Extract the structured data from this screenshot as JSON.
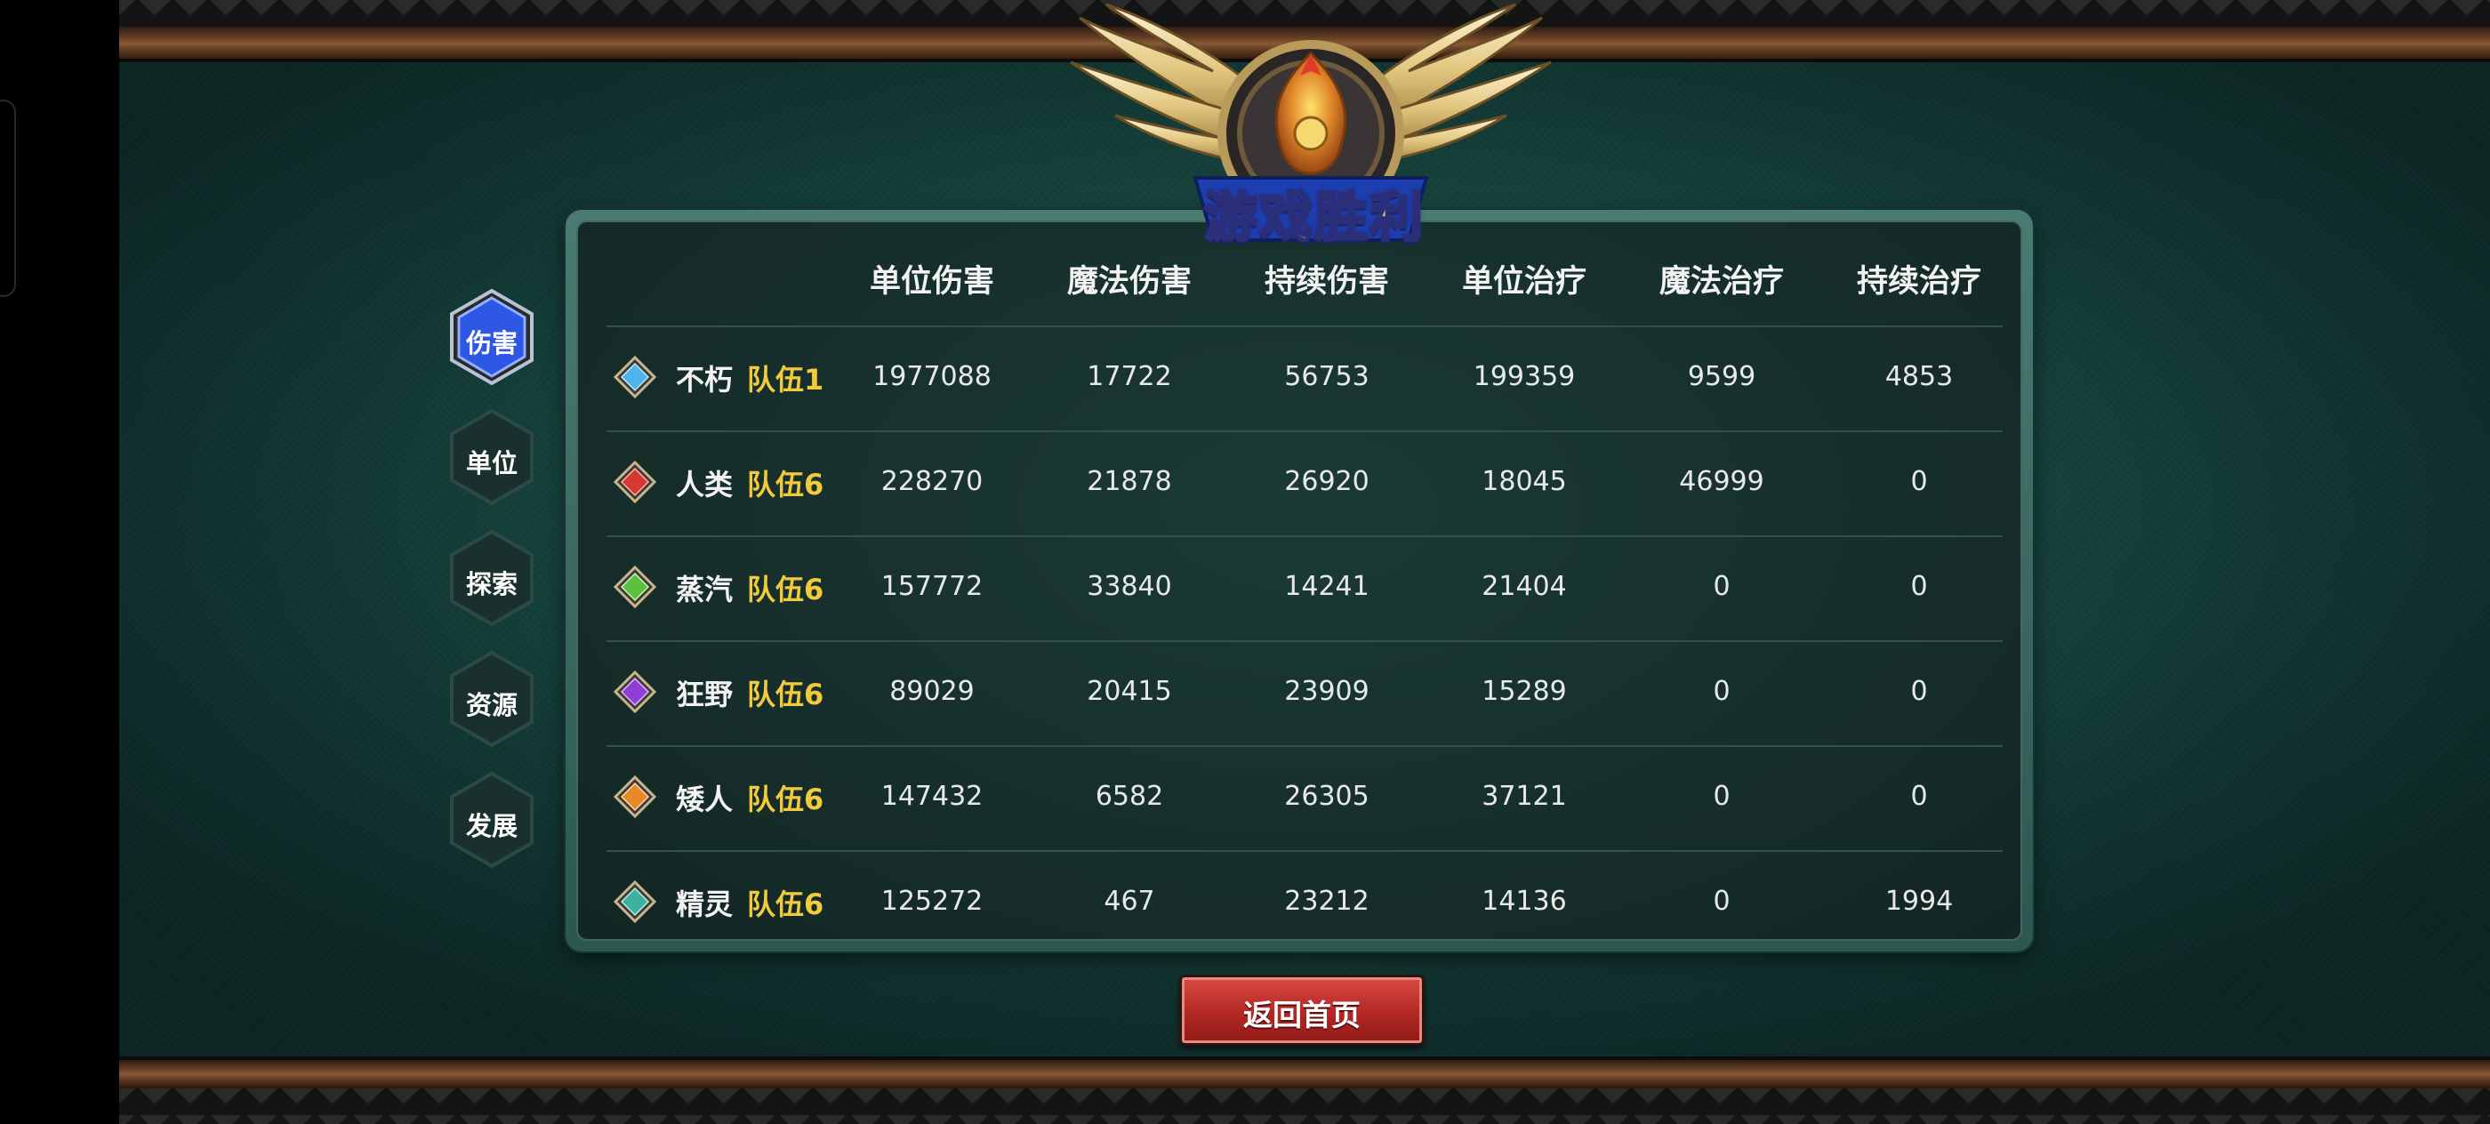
{
  "title": "游戏胜利",
  "tabs": [
    {
      "label": "伤害",
      "active": true
    },
    {
      "label": "单位",
      "active": false
    },
    {
      "label": "探索",
      "active": false
    },
    {
      "label": "资源",
      "active": false
    },
    {
      "label": "发展",
      "active": false
    }
  ],
  "table": {
    "headers": [
      "单位伤害",
      "魔法伤害",
      "持续伤害",
      "单位治疗",
      "魔法治疗",
      "持续治疗"
    ],
    "rows": [
      {
        "gem_color": "#4fb4e8",
        "race": "不朽",
        "team": "队伍1",
        "values": [
          "1977088",
          "17722",
          "56753",
          "199359",
          "9599",
          "4853"
        ]
      },
      {
        "gem_color": "#d8392f",
        "race": "人类",
        "team": "队伍6",
        "values": [
          "228270",
          "21878",
          "26920",
          "18045",
          "46999",
          "0"
        ]
      },
      {
        "gem_color": "#5cc23e",
        "race": "蒸汽",
        "team": "队伍6",
        "values": [
          "157772",
          "33840",
          "14241",
          "21404",
          "0",
          "0"
        ]
      },
      {
        "gem_color": "#8f3fd6",
        "race": "狂野",
        "team": "队伍6",
        "values": [
          "89029",
          "20415",
          "23909",
          "15289",
          "0",
          "0"
        ]
      },
      {
        "gem_color": "#e58a25",
        "race": "矮人",
        "team": "队伍6",
        "values": [
          "147432",
          "6582",
          "26305",
          "37121",
          "0",
          "0"
        ]
      },
      {
        "gem_color": "#3db0a0",
        "race": "精灵",
        "team": "队伍6",
        "values": [
          "125272",
          "467",
          "23212",
          "14136",
          "0",
          "1994"
        ]
      }
    ]
  },
  "return_button": "返回首页",
  "colors": {
    "team_text": "#f2cb3c",
    "active_tab": "#2f57e6",
    "button_red": "#c0302b"
  }
}
